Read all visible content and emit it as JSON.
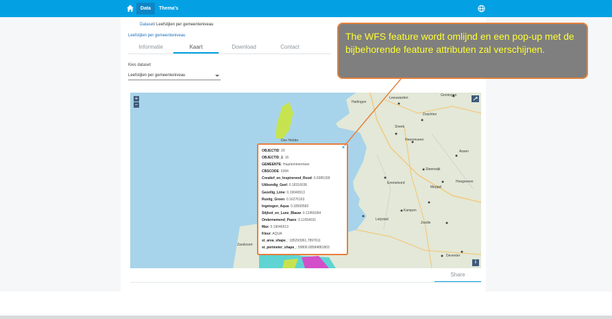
{
  "topbar": {
    "home_icon": "home-icon",
    "nav": [
      {
        "label": "Data",
        "active": true
      },
      {
        "label": "Thema's",
        "active": false
      }
    ],
    "globe_icon": "globe-icon",
    "color": "#03a1e4"
  },
  "breadcrumb": {
    "link": "Dataset",
    "current": "/ Leefstijlen per gemeenteniveau"
  },
  "dataset_link": "Leefstijlen per gemeenteniveau",
  "tabs": [
    {
      "label": "Informatie"
    },
    {
      "label": "Kaart"
    },
    {
      "label": "Download"
    },
    {
      "label": "Contact"
    }
  ],
  "active_tab": "Kaart",
  "dataset_select": {
    "label": "Kies dataset",
    "value": "Leefstijlen per gemeenteniveau"
  },
  "map": {
    "zoom_in": "+",
    "zoom_out": "−",
    "info": "i",
    "places": [
      "Harlingen",
      "Leeuwarden",
      "Groningen",
      "Drachten",
      "Sneek",
      "Heerenveen",
      "Assen",
      "Steenwijk",
      "Emmeloord",
      "Meppel",
      "Hoogeveen",
      "Lelystad",
      "Kampen",
      "Zwolle",
      "Zandvoort",
      "Deventer",
      "Den Helder"
    ]
  },
  "popup": {
    "close": "×",
    "attributes": [
      {
        "key": "OBJECTID",
        "value": "20"
      },
      {
        "key": "OBJECTID_1",
        "value": "16"
      },
      {
        "key": "GEMEENTE",
        "value": "Haarlemmermeer"
      },
      {
        "key": "CBSCODE",
        "value": "0394"
      },
      {
        "key": "Creatief_en_Inspirerend_Rood",
        "value": "0.0385158"
      },
      {
        "key": "Uitbundig_Geel",
        "value": "0.18316036"
      },
      {
        "key": "Gezellig_Lime",
        "value": "0.19046513"
      },
      {
        "key": "Rustig_Groen",
        "value": "0.16276163"
      },
      {
        "key": "Ingetogen_Aqua",
        "value": "0.18500582"
      },
      {
        "key": "Stijlvol_en_Luxe_Blauw",
        "value": "0.12455094"
      },
      {
        "key": "Ondernemend_Paars",
        "value": "0.11554031"
      },
      {
        "key": "Max",
        "value": "0.19046513"
      },
      {
        "key": "Kleur",
        "value": "AQUA"
      },
      {
        "key": "st_area_shape_",
        "value": "185293961.7897611"
      },
      {
        "key": "st_perimeter_shape_",
        "value": "59806.68584881803"
      }
    ]
  },
  "share": {
    "label": "Share"
  },
  "callout": {
    "text": "The WFS feature wordt omlijnd en een pop-up met de bijbehorende feature attributen zal verschijnen."
  }
}
